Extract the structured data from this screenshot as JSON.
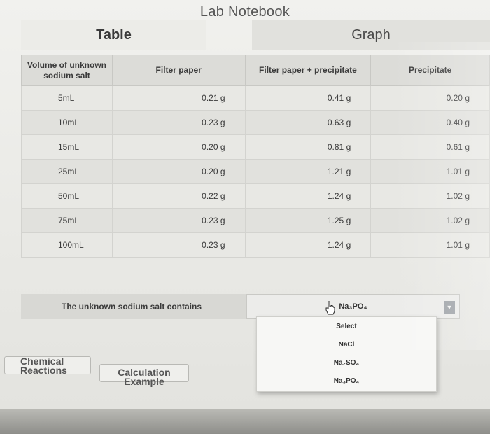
{
  "app": {
    "title": "Lab Notebook"
  },
  "tabs": [
    {
      "label": "Table",
      "active": true
    },
    {
      "label": "Graph",
      "active": false
    }
  ],
  "table": {
    "columns": [
      "Volume of unknown sodium salt",
      "Filter paper",
      "Filter paper + precipitate",
      "Precipitate"
    ],
    "rows": [
      [
        "5mL",
        "0.21 g",
        "0.41 g",
        "0.20 g"
      ],
      [
        "10mL",
        "0.23 g",
        "0.63 g",
        "0.40 g"
      ],
      [
        "15mL",
        "0.20 g",
        "0.81 g",
        "0.61 g"
      ],
      [
        "25mL",
        "0.20 g",
        "1.21 g",
        "1.01 g"
      ],
      [
        "50mL",
        "0.22 g",
        "1.24 g",
        "1.02 g"
      ],
      [
        "75mL",
        "0.23 g",
        "1.25 g",
        "1.02 g"
      ],
      [
        "100mL",
        "0.23 g",
        "1.24 g",
        "1.01 g"
      ]
    ]
  },
  "answer": {
    "prompt": "The unknown sodium salt contains",
    "selected": "Na₃PO₄",
    "options": [
      "Select",
      "NaCl",
      "Na₂SO₄",
      "Na₃PO₄"
    ]
  },
  "buttons": {
    "chemical_reactions": [
      "Chemical",
      "Reactions"
    ],
    "calculation_example": [
      "Calculation",
      "Example"
    ]
  },
  "colors": {
    "accent": "#9fa3a8",
    "background": "#e9e9e5"
  }
}
